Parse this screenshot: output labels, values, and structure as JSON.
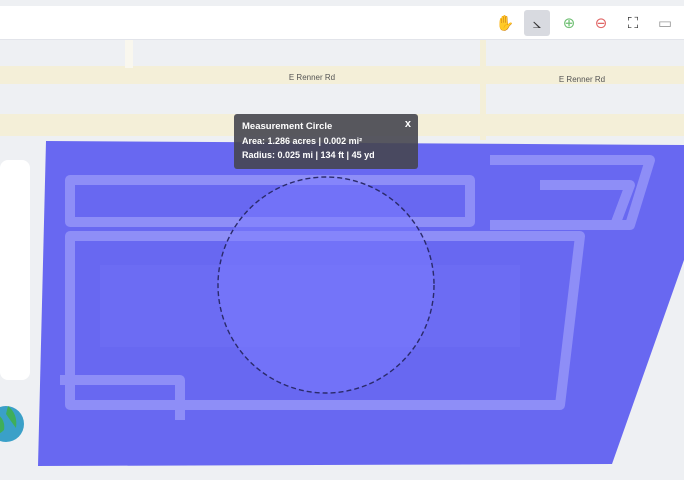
{
  "map": {
    "roads": [
      {
        "label": "E Renner Rd"
      },
      {
        "label": "E Renner Rd"
      }
    ]
  },
  "toolbar": {
    "tools": [
      {
        "icon": "hand-pan-icon",
        "glyph": "✋",
        "active": false
      },
      {
        "icon": "measure-angle-icon",
        "glyph": "⦣",
        "active": true
      },
      {
        "icon": "add-circle-icon",
        "glyph": "⊕",
        "active": false
      },
      {
        "icon": "remove-circle-icon",
        "glyph": "⊖",
        "active": false
      },
      {
        "icon": "fit-extent-icon",
        "glyph": "⛶",
        "active": false
      },
      {
        "icon": "more-icon",
        "glyph": "▭",
        "active": false
      }
    ]
  },
  "popup": {
    "title": "Measurement Circle",
    "close": "x",
    "area": "Area: 1.286 acres | 0.002 mi²",
    "radius": "Radius: 0.025 mi | 134 ft | 45 yd"
  },
  "colors": {
    "parcel_fill": "#5050f0",
    "road": "#f4efd8",
    "lot_line": "#8e8ef7",
    "circle_fill": "#7b7bff"
  }
}
